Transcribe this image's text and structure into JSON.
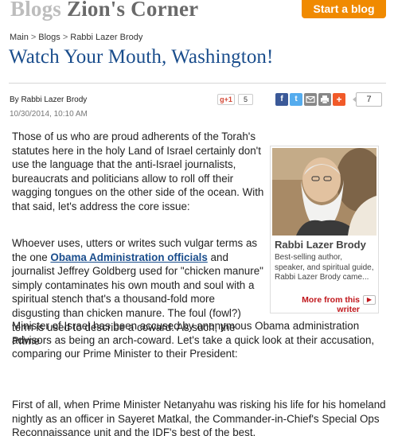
{
  "header": {
    "brand_part1": "Blogs",
    "brand_part2": "Zion's Corner",
    "start_blog_label": "Start a blog"
  },
  "breadcrumb": {
    "items": [
      "Main",
      "Blogs",
      "Rabbi Lazer Brody"
    ],
    "separator": ">"
  },
  "article": {
    "title": "Watch Your Mouth, Washington!",
    "byline": "By Rabbi Lazer Brody",
    "date": "10/30/2014, 10:10 AM",
    "paragraphs": {
      "p1": "Those of us who are proud adherents of the Torah's statutes here in the holy Land of Israel certainly don't use the language that the anti-Israel journalists, bureaucrats and politicians allow to roll off their wagging tongues on the other side of the ocean. With that said, let's address the core issue:",
      "p2_before": "Whoever uses, utters or writes such vulgar terms as the one ",
      "p2_link": "Obama Administration officials",
      "p2_after": " and journalist Jeffrey Goldberg used for \"chicken manure\" simply contaminates his own mouth and soul with a spiritual stench that's a thousand-fold more disgusting than chicken manure. The foul (fowl?) term is used to describe a coward. As such, the Prime",
      "p3": "Minister of Israel has been accused by anonymous Obama administration advisors as being an arch-coward. Let's take a quick look at their accusation, comparing our Prime Minister to their President:",
      "p4": "First of all, when Prime Minister Netanyahu was risking his life for his homeland nightly as an officer in Sayeret Matkal, the Commander-in-Chief's Special Ops Reconnaissance unit and the IDF's best of the best,"
    }
  },
  "social": {
    "gplus_label": "g+1",
    "gplus_count": "5",
    "share_count": "7",
    "icons": [
      "facebook-icon",
      "twitter-icon",
      "email-icon",
      "print-icon",
      "plus-icon"
    ]
  },
  "author_box": {
    "name": "Rabbi Lazer Brody",
    "bio": "Best-selling author, speaker, and spiritual guide, Rabbi Lazer Brody came...",
    "more_label": "More from this writer"
  },
  "colors": {
    "title_blue": "#1a4d8c",
    "orange_button": "#f08a00",
    "more_red": "#c0161b"
  }
}
